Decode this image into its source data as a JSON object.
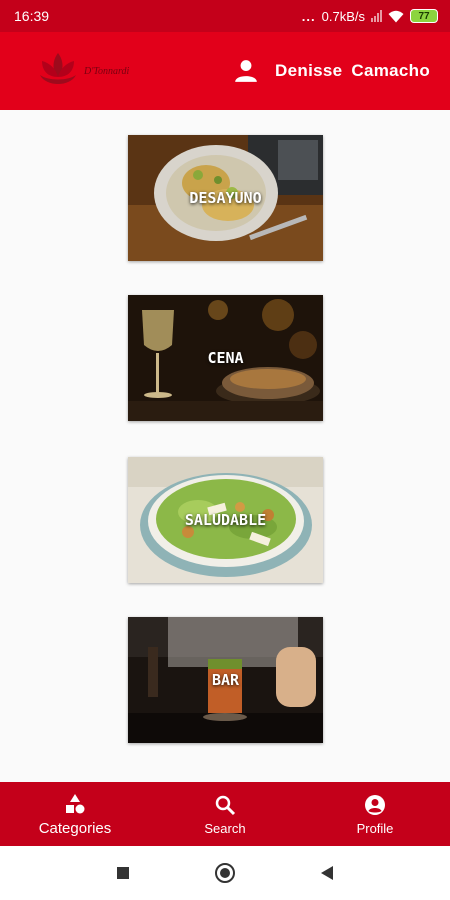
{
  "status_bar": {
    "time": "16:39",
    "dots": "...",
    "net_speed": "0.7kB/s",
    "battery": "77"
  },
  "header": {
    "logo_text": "D'Tonnardi",
    "user_name": "Denisse  Camacho",
    "icons": {
      "user": "person-icon"
    }
  },
  "categories": [
    {
      "label": "DESAYUNO"
    },
    {
      "label": "CENA"
    },
    {
      "label": "SALUDABLE"
    },
    {
      "label": "BAR"
    }
  ],
  "bottom_nav": {
    "items": [
      {
        "label": "Categories",
        "icon": "shapes-icon",
        "active": true
      },
      {
        "label": "Search",
        "icon": "search-icon",
        "active": false
      },
      {
        "label": "Profile",
        "icon": "account-circle-icon",
        "active": false
      }
    ]
  },
  "colors": {
    "status_bar": "#c4001a",
    "header": "#e2001a",
    "bottom_nav": "#c4001a",
    "background": "#fafafa"
  }
}
